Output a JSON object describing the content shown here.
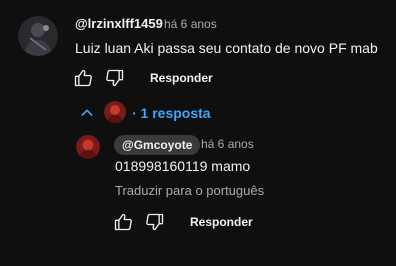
{
  "comment": {
    "author": "@lrzinxlff1459",
    "time": "há 6 anos",
    "text": "Luiz luan Aki passa seu contato de novo PF mab",
    "reply_label": "Responder"
  },
  "replies_toggle": {
    "label": "· 1 resposta"
  },
  "reply": {
    "author": "@Gmcoyote",
    "time": "há 6 anos",
    "text": "018998160119 mamo",
    "translate_label": "Traduzir para o português",
    "reply_label": "Responder"
  },
  "colors": {
    "background": "#0f0f0f",
    "link": "#3ea6ff",
    "muted": "#aaaaaa",
    "badge": "#3a3a3a"
  },
  "icons": [
    "thumbs-up-icon",
    "thumbs-down-icon",
    "chevron-up-icon"
  ]
}
